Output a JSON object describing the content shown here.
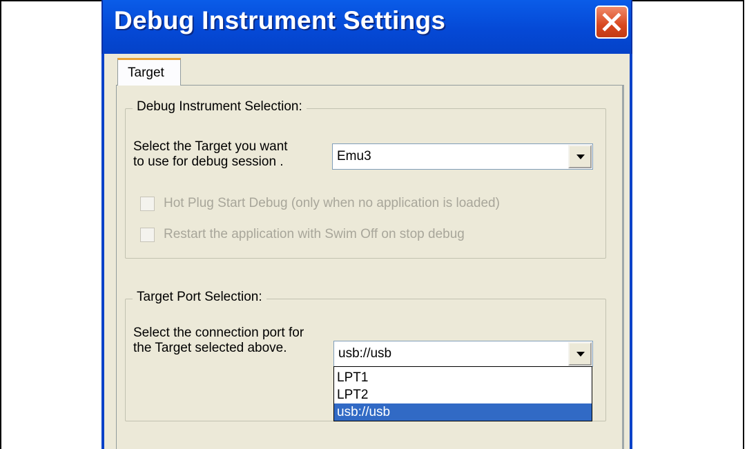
{
  "window": {
    "title": "Debug Instrument Settings"
  },
  "tabs": [
    {
      "label": "Target",
      "active": true
    }
  ],
  "instrument_group": {
    "legend": "Debug Instrument Selection:",
    "prompt_line1": "Select the Target you want",
    "prompt_line2": "to use for debug session .",
    "target_value": "Emu3",
    "checkbox_hotplug": {
      "label": "Hot Plug Start Debug (only when no application is loaded)",
      "checked": false,
      "enabled": false
    },
    "checkbox_restart": {
      "label": "Restart the application with Swim Off on stop debug",
      "checked": false,
      "enabled": false
    }
  },
  "port_group": {
    "legend": "Target Port Selection:",
    "prompt_line1": "Select the connection port for",
    "prompt_line2": "the Target selected above.",
    "port_value": "usb://usb",
    "options": [
      "LPT1",
      "LPT2",
      "usb://usb"
    ],
    "selected_option": "usb://usb"
  },
  "colors": {
    "titlebar": "#0549d6",
    "close_button": "#d8481f",
    "selection": "#316ac5",
    "dialog_bg": "#ece9d8"
  },
  "icons": {
    "close": "close-x-icon",
    "dropdown": "chevron-down-icon"
  }
}
